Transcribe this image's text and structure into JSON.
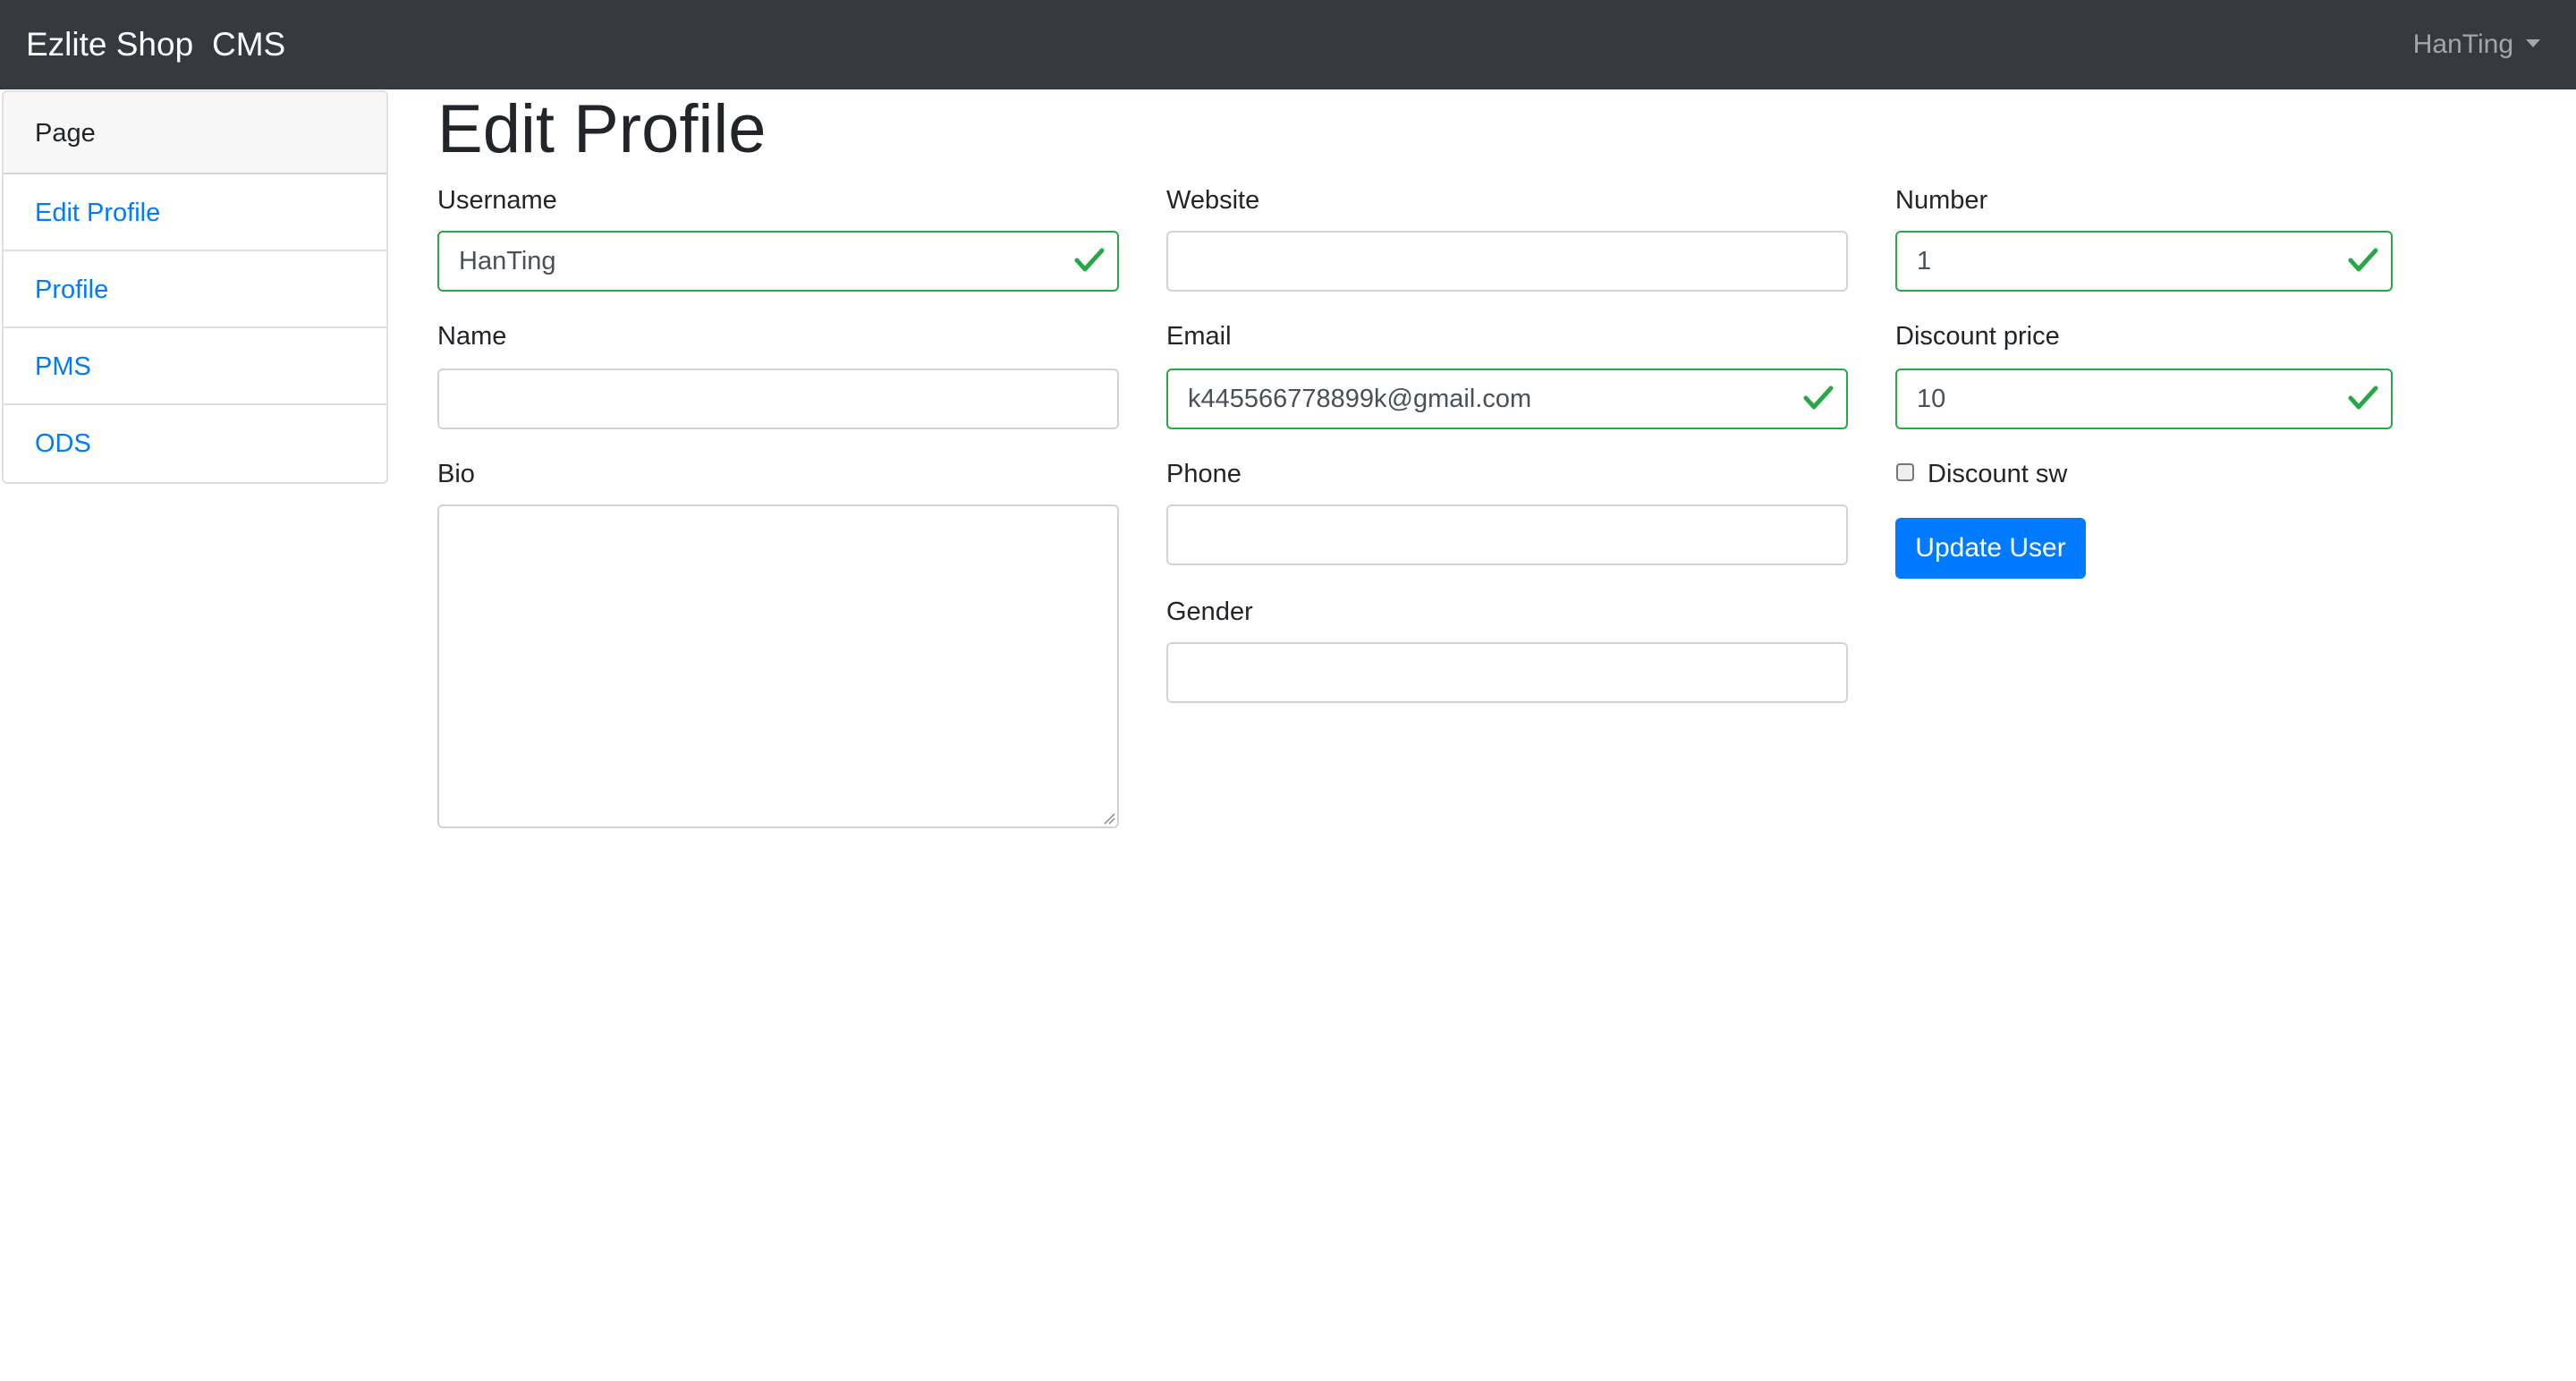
{
  "navbar": {
    "brand": "Ezlite Shop",
    "section": "CMS",
    "user": "HanTing"
  },
  "sidebar": {
    "header": "Page",
    "items": [
      {
        "label": "Edit Profile"
      },
      {
        "label": "Profile"
      },
      {
        "label": "PMS"
      },
      {
        "label": "ODS"
      }
    ]
  },
  "page": {
    "title": "Edit Profile"
  },
  "form": {
    "username": {
      "label": "Username",
      "value": "HanTing",
      "valid": true
    },
    "name": {
      "label": "Name",
      "value": ""
    },
    "bio": {
      "label": "Bio",
      "value": ""
    },
    "website": {
      "label": "Website",
      "value": ""
    },
    "email": {
      "label": "Email",
      "value": "k445566778899k@gmail.com",
      "valid": true
    },
    "phone": {
      "label": "Phone",
      "value": ""
    },
    "gender": {
      "label": "Gender",
      "value": ""
    },
    "number": {
      "label": "Number",
      "value": "1",
      "valid": true
    },
    "discount_price": {
      "label": "Discount price",
      "value": "10",
      "valid": true
    },
    "discount_sw": {
      "label": "Discount sw",
      "checked": false
    },
    "submit_label": "Update User"
  },
  "colors": {
    "navbar": "#343a40",
    "link": "#007bff",
    "valid": "#28a745",
    "primary_button": "#007bff"
  },
  "icons": {
    "valid": "check-icon",
    "user_menu": "caret-down-icon"
  }
}
